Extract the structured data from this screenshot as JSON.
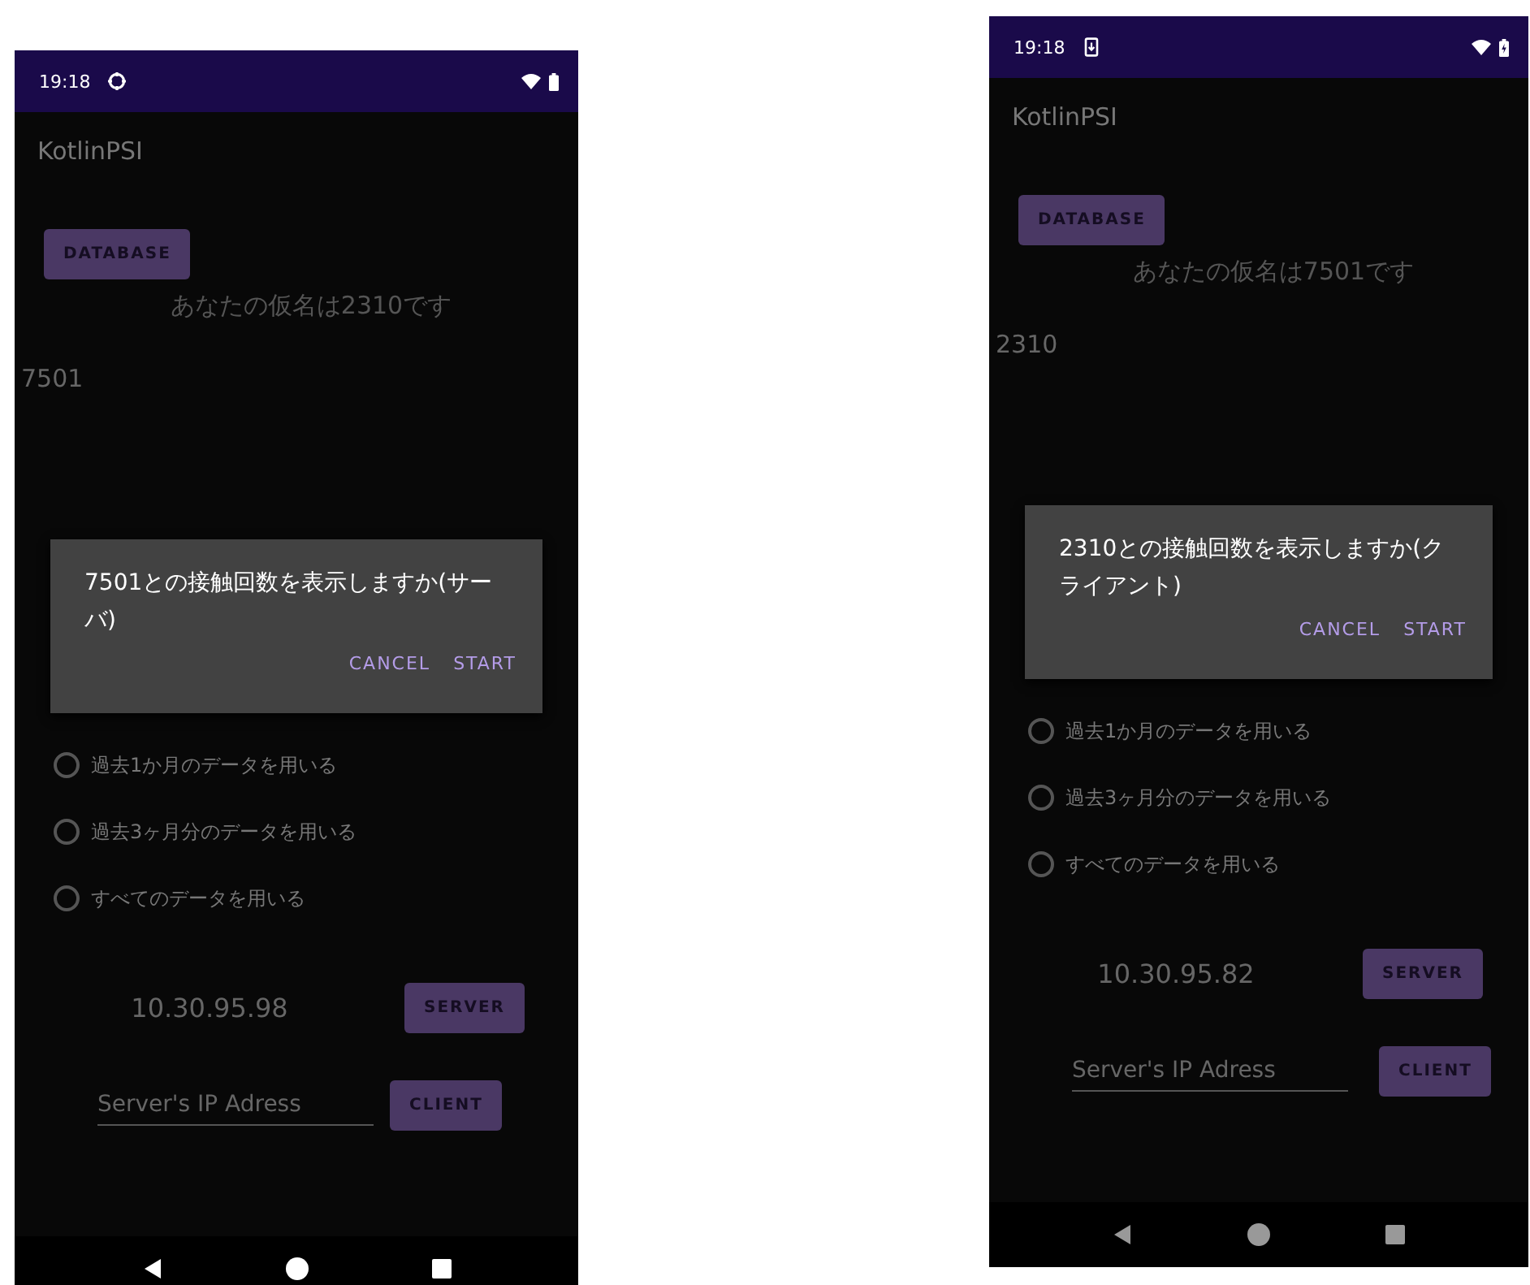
{
  "phones": [
    {
      "status_bar": {
        "time": "19:18",
        "notification_icon": {
          "kind": "sync"
        },
        "battery_charging": false
      },
      "app_title": "KotlinPSI",
      "database_button": "DATABASE",
      "pseudonym_text": "あなたの仮名は2310です",
      "peer_id": "7501",
      "dialog": {
        "message": "7501との接触回数を表示しますか(サーバ)",
        "actions": [
          "CANCEL",
          "START"
        ]
      },
      "options": [
        {
          "label": "過去1か月のデータを用いる",
          "selected": false
        },
        {
          "label": "過去3ヶ月分のデータを用いる",
          "selected": false
        },
        {
          "label": "すべてのデータを用いる",
          "selected": false
        }
      ],
      "ip_address": "10.30.95.98",
      "server_button": "SERVER",
      "ip_field": {
        "placeholder": "Server's IP Adress"
      },
      "client_button": "CLIENT"
    },
    {
      "status_bar": {
        "time": "19:18",
        "notification_icon": {
          "kind": "download"
        },
        "battery_charging": true
      },
      "app_title": "KotlinPSI",
      "database_button": "DATABASE",
      "pseudonym_text": "あなたの仮名は7501です",
      "peer_id": "2310",
      "dialog": {
        "message": "2310との接触回数を表示しますか(クライアント)",
        "actions": [
          "CANCEL",
          "START"
        ]
      },
      "options": [
        {
          "label": "過去1か月のデータを用いる",
          "selected": false
        },
        {
          "label": "過去3ヶ月分のデータを用いる",
          "selected": false
        },
        {
          "label": "すべてのデータを用いる",
          "selected": false
        }
      ],
      "ip_address": "10.30.95.82",
      "server_button": "SERVER",
      "ip_field": {
        "placeholder": "Server's IP Adress"
      },
      "client_button": "CLIENT"
    }
  ]
}
